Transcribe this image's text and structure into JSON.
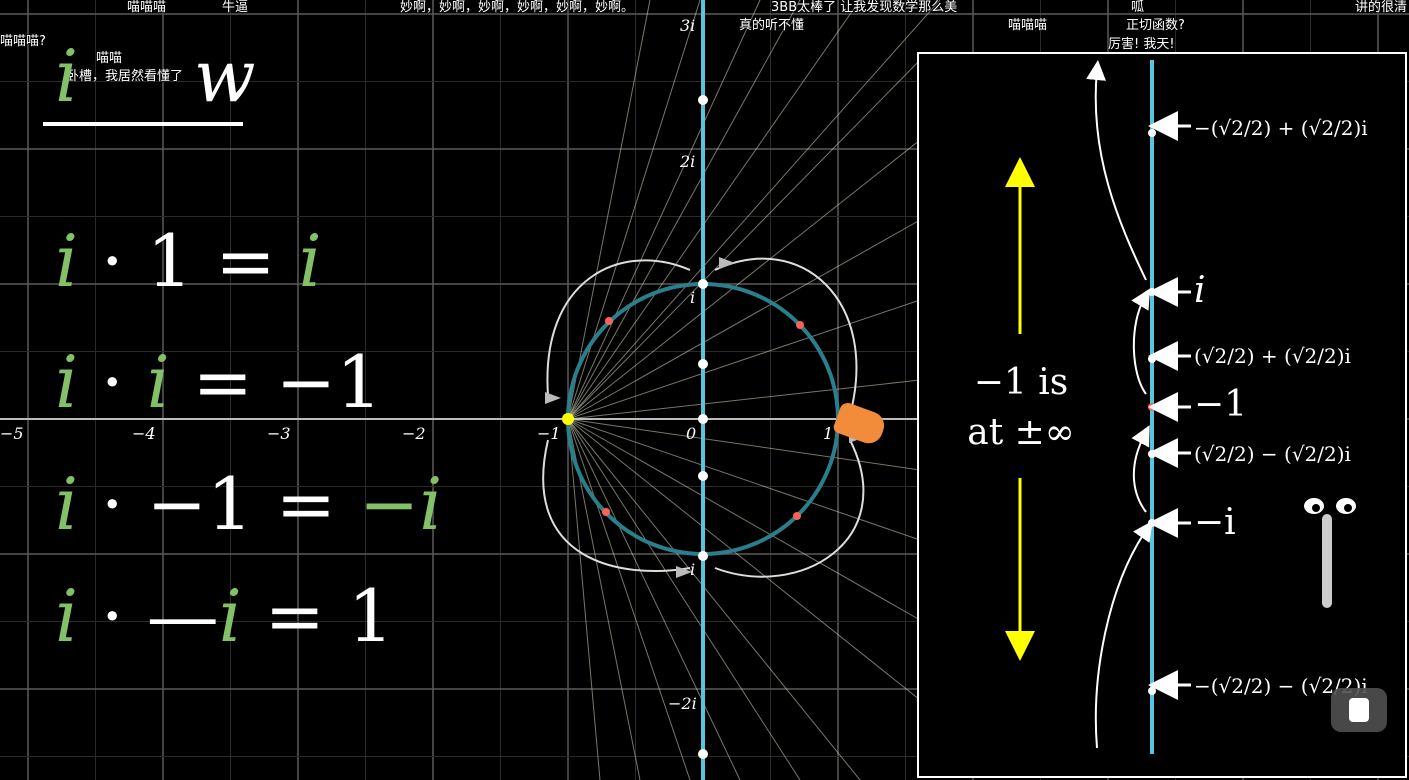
{
  "danmaku": [
    "喵喵喵",
    "牛逼",
    "妙啊，妙啊，妙啊，妙啊，妙啊，妙啊。",
    "3BB太棒了 让我发现数学那么美",
    "喵喵喵",
    "呱",
    "讲的很清",
    "真的听不懂",
    "正切函数?",
    "厉害! 我天!",
    "喵喵喵?",
    "喵喵",
    "卧槽，我居然看懂了"
  ],
  "header_eq": {
    "left": "i",
    "right": "w"
  },
  "equations": [
    {
      "a": "i",
      "op": "·",
      "b": "1",
      "eq": "=",
      "r": "i"
    },
    {
      "a": "i",
      "op": "·",
      "b": "i",
      "eq": "=",
      "r": "−1"
    },
    {
      "a": "i",
      "op": "·",
      "b": "−1",
      "eq": "=",
      "r": "−i"
    },
    {
      "a": "i",
      "op": "·",
      "b": "−i",
      "eq": "=",
      "r": "1"
    }
  ],
  "axis_ticks": {
    "real": [
      "−5",
      "−4",
      "−3",
      "−2",
      "−1",
      "0",
      "1"
    ],
    "imag": [
      "3i",
      "2i",
      "i",
      "i",
      "−2i"
    ]
  },
  "inset": {
    "labels": [
      "−(√2/2) + (√2/2)i",
      "i",
      "(√2/2) + (√2/2)i",
      "−1",
      "(√2/2) − (√2/2)i",
      "−i",
      "−(√2/2) − (√2/2)i"
    ],
    "infinity_text": [
      "−1 is",
      "at ±∞"
    ]
  },
  "colors": {
    "accent_green": "#83c167",
    "axis_blue": "#58c4dd",
    "circle": "#2a7f8c",
    "yellow": "#ffff00",
    "red_dot": "#fc6255"
  },
  "controls": {
    "play_icon": "play-icon"
  }
}
